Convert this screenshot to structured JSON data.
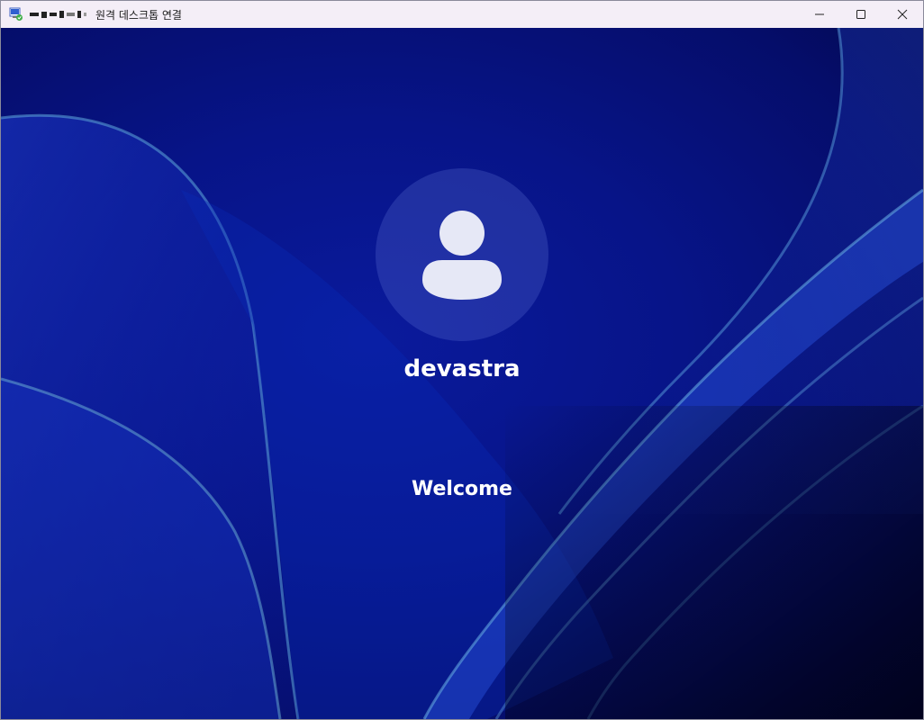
{
  "window": {
    "title": "원격 데스크톱 연결",
    "host_redacted": "■■■■■■"
  },
  "controls": {
    "minimize": "minimize-icon",
    "maximize": "maximize-icon",
    "close": "close-icon"
  },
  "session": {
    "username": "devastra",
    "status": "Welcome"
  },
  "colors": {
    "titlebar": "#f4eef7",
    "desktop_bg": "#071488",
    "text": "#ffffff"
  }
}
